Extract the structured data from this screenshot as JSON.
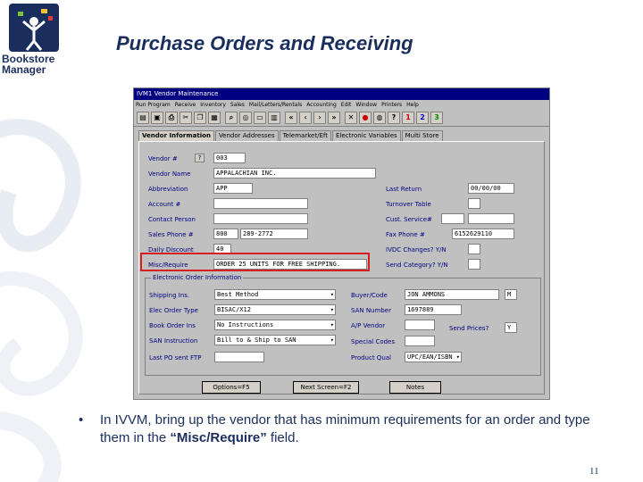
{
  "logo": {
    "line1": "Bookstore",
    "line2": "Manager"
  },
  "slide_title": "Purchase Orders and Receiving",
  "window": {
    "title": "IVM1 Vendor Maintenance",
    "menu": [
      "Run Program",
      "Receive",
      "Inventory",
      "Sales",
      "Mail/Letters/Rentals",
      "Accounting",
      "Edit",
      "Window",
      "Printers",
      "Help"
    ],
    "toolbar_numbers": [
      "1",
      "2",
      "3"
    ],
    "tabs": [
      "Vendor Information",
      "Vendor Addresses",
      "Telemarket/Eft",
      "Electronic Variables",
      "Multi Store"
    ],
    "fields": {
      "vendor_num": {
        "label": "Vendor #",
        "value": "003"
      },
      "vendor_name": {
        "label": "Vendor Name",
        "value": "APPALACHIAN INC."
      },
      "abbreviation": {
        "label": "Abbreviation",
        "value": "APP"
      },
      "account_num": {
        "label": "Account #",
        "value": ""
      },
      "contact_person": {
        "label": "Contact Person",
        "value": ""
      },
      "sales_phone": {
        "label": "Sales Phone #",
        "area": "800",
        "value": "289-2772"
      },
      "daily_discount": {
        "label": "Daily Discount",
        "value": "40"
      },
      "misc_require": {
        "label": "Misc/Require",
        "value": "ORDER 25 UNITS FOR FREE SHIPPING."
      },
      "last_return": {
        "label": "Last Return",
        "value": "00/00/00"
      },
      "turnover_table": {
        "label": "Turnover Table",
        "value": ""
      },
      "cust_service": {
        "label": "Cust. Service#",
        "value": ""
      },
      "fax_phone": {
        "label": "Fax Phone #",
        "value": "6152629110"
      },
      "ivdc_changes": {
        "label": "IVDC Changes? Y/N",
        "value": ""
      },
      "send_category": {
        "label": "Send Category? Y/N",
        "value": ""
      }
    },
    "electronic_group": {
      "title": "Electronic Order Information",
      "shipping_ins": {
        "label": "Shipping Ins.",
        "value": "Best Method"
      },
      "elec_order_type": {
        "label": "Elec Order Type",
        "value": "BISAC/X12"
      },
      "book_order_ins": {
        "label": "Book Order Ins",
        "value": "No Instructions"
      },
      "san_instruction": {
        "label": "SAN Instruction",
        "value": "Bill to & Ship to SAN"
      },
      "last_po_sent": {
        "label": "Last PO sent FTP",
        "value": ""
      },
      "buyer_code": {
        "label": "Buyer/Code",
        "value": "JON AMMONS",
        "code": "M"
      },
      "san_number": {
        "label": "SAN Number",
        "value": "1697889"
      },
      "ap_vendor": {
        "label": "A/P Vendor",
        "value": ""
      },
      "send_prices": {
        "label": "Send Prices?",
        "value": "Y"
      },
      "special_codes": {
        "label": "Special Codes",
        "value": ""
      },
      "product_qual": {
        "label": "Product Qual",
        "value": "UPC/EAN/ISBN"
      }
    },
    "buttons": {
      "options": "Options=F5",
      "next_screen": "Next Screen=F2",
      "notes": "Notes"
    }
  },
  "caption": {
    "bullet": "•",
    "before": "In IVVM, bring up the vendor that has minimum requirements for an order and type them in the ",
    "emph": "“Misc/Require”",
    "after": " field."
  },
  "page_number": "11",
  "colors": {
    "title": "#1a2e5e",
    "highlight": "#d42020",
    "win_title": "#000080"
  }
}
